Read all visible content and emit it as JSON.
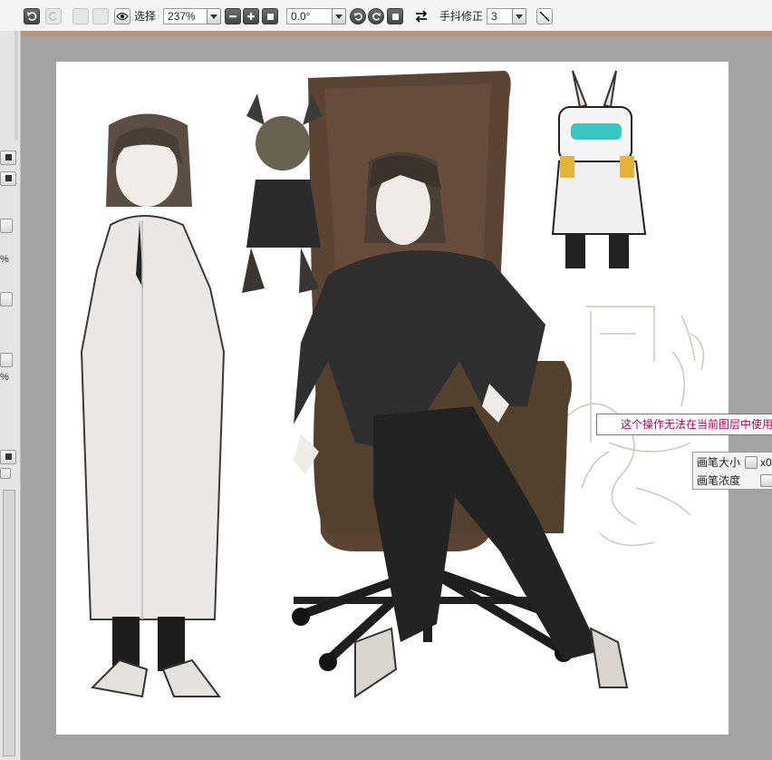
{
  "toolbar": {
    "select_label": "选择",
    "zoom_value": "237%",
    "rotation_value": "0.0°",
    "stabilizer_label": "手抖修正",
    "stabilizer_value": "3"
  },
  "left_panel": {
    "percent_1": "%",
    "percent_2": "%"
  },
  "canvas": {
    "tooltip_text": "这个操作无法在当前图层中使用",
    "brush_size_label": "画笔大小",
    "brush_size_value": "x0",
    "brush_density_label": "画笔浓度"
  },
  "colors": {
    "accent": "#d58b55",
    "tooltip_text": "#b00058",
    "canvas_bg": "#a3a3a3",
    "paper": "#ffffff"
  },
  "icons": [
    "undo-icon",
    "redo-icon",
    "eye-icon",
    "minus-icon",
    "plus-icon",
    "stop-icon",
    "rotate-left-icon",
    "rotate-right-icon",
    "flip-icon",
    "line-tool-icon",
    "chevron-down-icon"
  ]
}
